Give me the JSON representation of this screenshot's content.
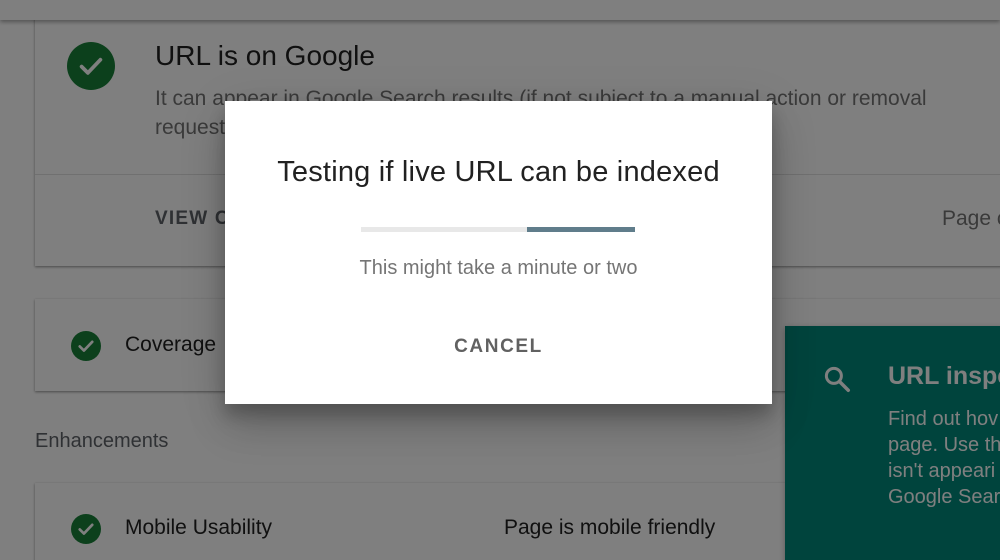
{
  "status_card": {
    "title": "URL is on Google",
    "description": "It can appear in Google Search results (if not subject to a manual action or removal request",
    "view_crawled_label": "VIEW C",
    "page_changed_label": "Page c"
  },
  "coverage": {
    "label": "Coverage"
  },
  "enhancements": {
    "heading": "Enhancements",
    "mobile_usability": {
      "label": "Mobile Usability",
      "value": "Page is mobile friendly"
    }
  },
  "help_panel": {
    "title": "URL inspe",
    "lines": [
      "Find out hov",
      "page. Use th",
      "isn't appeari",
      "Google Sear"
    ],
    "icon": "search-icon"
  },
  "dialog": {
    "title": "Testing if live URL can be indexed",
    "subtitle": "This might take a minute or two",
    "cancel_label": "CANCEL"
  },
  "colors": {
    "success_green": "#188038",
    "help_teal": "#00897b",
    "progress_bar": "#607d8b"
  }
}
